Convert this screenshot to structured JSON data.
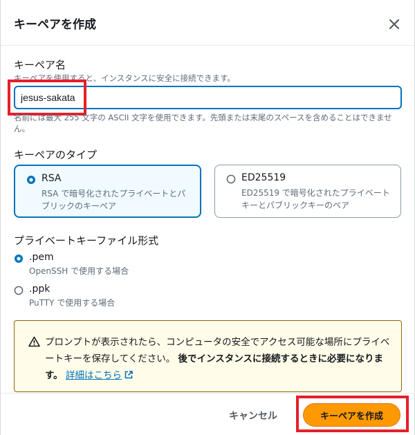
{
  "dialog": {
    "title": "キーペアを作成"
  },
  "name_field": {
    "label": "キーペア名",
    "description": "キーペアを使用すると、インスタンスに安全に接続できます。",
    "value": "jesus-sakata",
    "hint": "名前には最大 255 文字の ASCII 文字を使用できます。先頭または末尾のスペースを含めることはできません。"
  },
  "key_type": {
    "label": "キーペアのタイプ",
    "options": [
      {
        "title": "RSA",
        "description": "RSA で暗号化されたプライベートとパブリックのキーペア",
        "selected": true
      },
      {
        "title": "ED25519",
        "description": "ED25519 で暗号化されたプライベートキーとパブリックキーのペア",
        "selected": false
      }
    ]
  },
  "file_format": {
    "label": "プライベートキーファイル形式",
    "options": [
      {
        "label": ".pem",
        "description": "OpenSSH で使用する場合",
        "selected": true
      },
      {
        "label": ".ppk",
        "description": "PuTTY で使用する場合",
        "selected": false
      }
    ]
  },
  "alert": {
    "text_plain": "プロンプトが表示されたら、コンピュータの安全でアクセス可能な場所にプライベートキーを保存してください。",
    "text_bold": "後でインスタンスに接続するときに必要になります。",
    "link": "詳細はこちら",
    "icon": "warning-icon"
  },
  "footer": {
    "cancel_label": "キャンセル",
    "create_label": "キーペアを作成"
  },
  "colors": {
    "accent": "#0073bb",
    "primary_button": "#ff9900",
    "highlight": "#e5202b",
    "alert_bg": "#fffce9"
  }
}
